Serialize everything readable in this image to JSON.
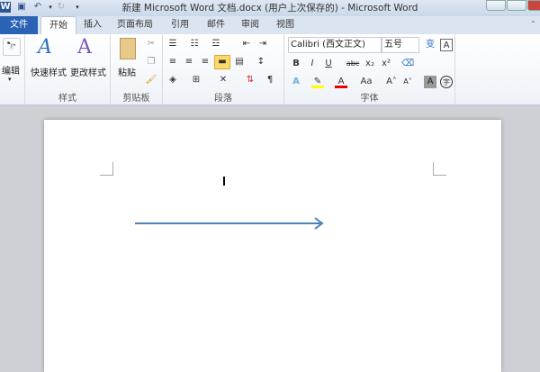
{
  "window": {
    "title": "新建 Microsoft Word 文档.docx (用户上次保存的)  -  Microsoft Word"
  },
  "tabs": [
    "文件",
    "开始",
    "插入",
    "页面布局",
    "引用",
    "邮件",
    "审阅",
    "视图"
  ],
  "groups": {
    "editing": {
      "button": "编辑"
    },
    "styles": {
      "label": "样式",
      "quick_styles": "快速样式",
      "change_styles": "更改样式"
    },
    "clipboard": {
      "label": "剪贴板",
      "paste": "粘贴"
    },
    "paragraph": {
      "label": "段落"
    },
    "font": {
      "label": "字体",
      "font_name": "Calibri (西文正文)",
      "font_size": "五号",
      "bold": "B",
      "italic": "I",
      "underline": "U",
      "strike": "abc",
      "subscript": "x₂",
      "superscript": "x²",
      "font_color": "A",
      "change_case": "Aa",
      "grow": "A˄",
      "shrink": "A˅",
      "char_shading": "A",
      "enclose": "字",
      "phonetic": "变",
      "border": "A"
    }
  },
  "colors": {
    "accent": "#2a62b4",
    "arrow": "#4f81bd",
    "highlight": "#ffff00",
    "font_color": "#e00000"
  }
}
